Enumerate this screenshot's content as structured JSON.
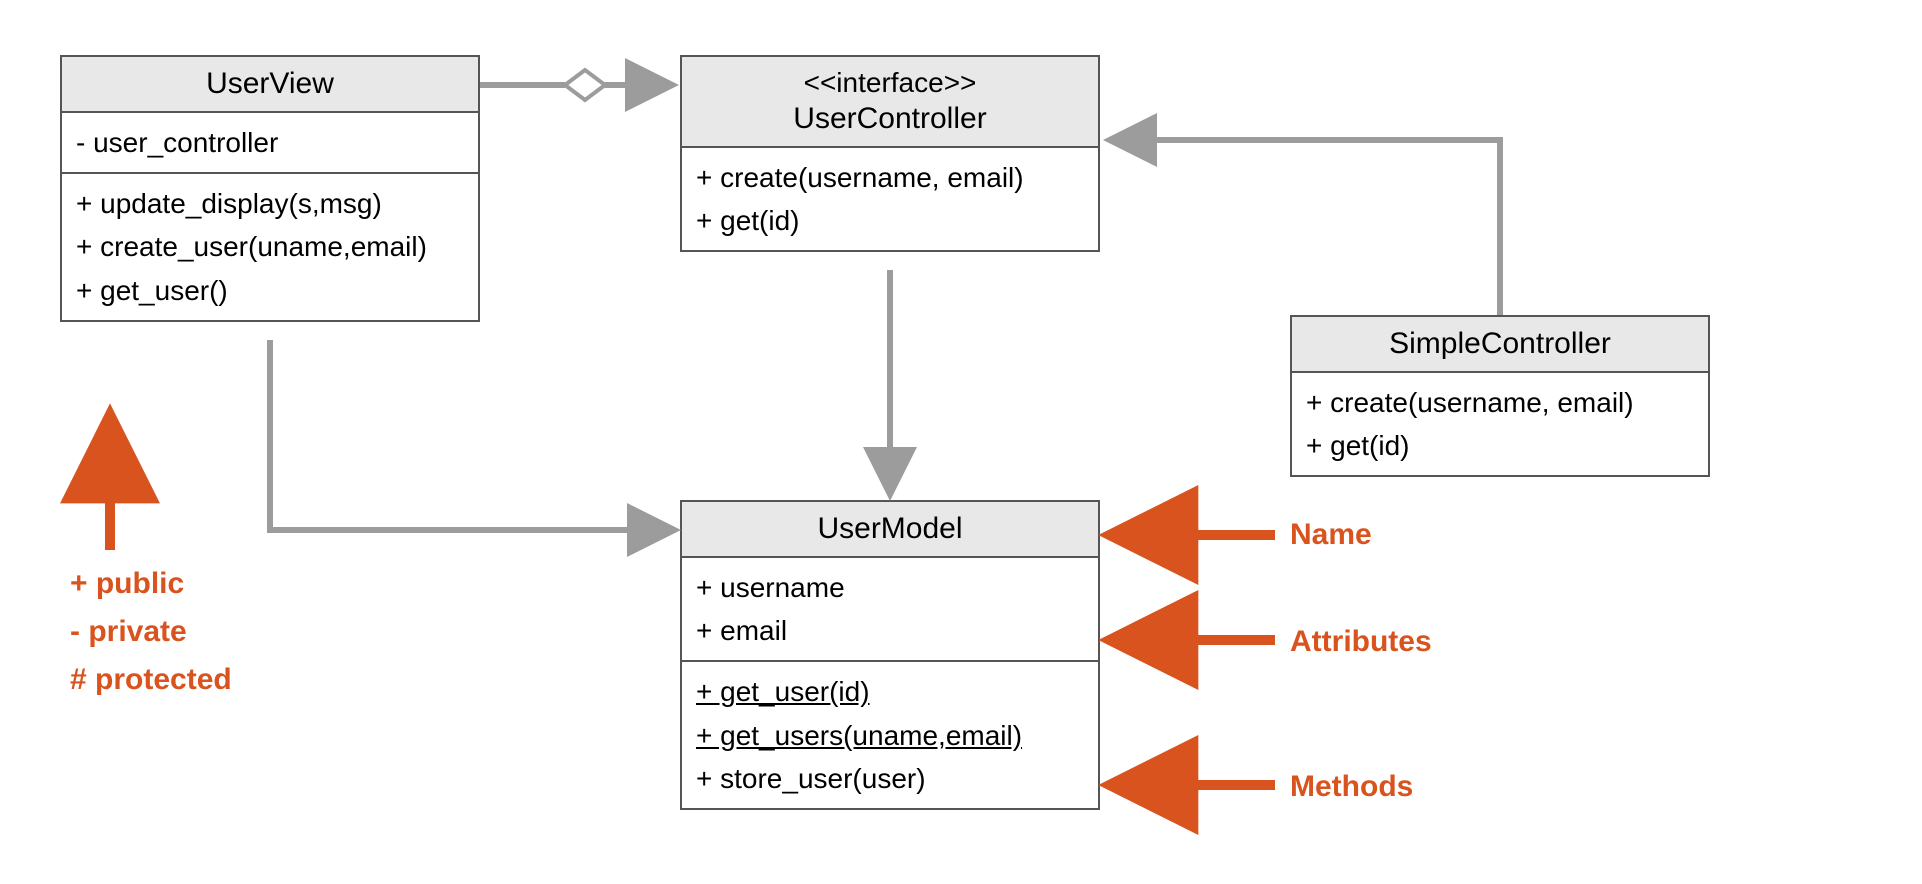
{
  "classes": {
    "userView": {
      "name": "UserView",
      "attributes": [
        "- user_controller"
      ],
      "methods": [
        "+ update_display(s,msg)",
        "+ create_user(uname,email)",
        "+ get_user()"
      ]
    },
    "userController": {
      "stereotype": "<<interface>>",
      "name": "UserController",
      "methods": [
        "+ create(username, email)",
        "+ get(id)"
      ]
    },
    "simpleController": {
      "name": "SimpleController",
      "methods": [
        "+ create(username, email)",
        "+ get(id)"
      ]
    },
    "userModel": {
      "name": "UserModel",
      "attributes": [
        "+ username",
        "+ email"
      ],
      "methods": [
        {
          "text": "+ get_user(id)",
          "underline": true
        },
        {
          "text": "+ get_users(uname,email)",
          "underline": true
        },
        {
          "text": "+ store_user(user)",
          "underline": false
        }
      ]
    }
  },
  "legend": {
    "public": "+ public",
    "private": "- private",
    "protected": "# protected"
  },
  "annotations": {
    "name": "Name",
    "attributes": "Attributes",
    "methods": "Methods"
  },
  "colors": {
    "box_border": "#555555",
    "box_header": "#e8e8e8",
    "arrow": "#9c9c9c",
    "annotation": "#d9531e"
  }
}
